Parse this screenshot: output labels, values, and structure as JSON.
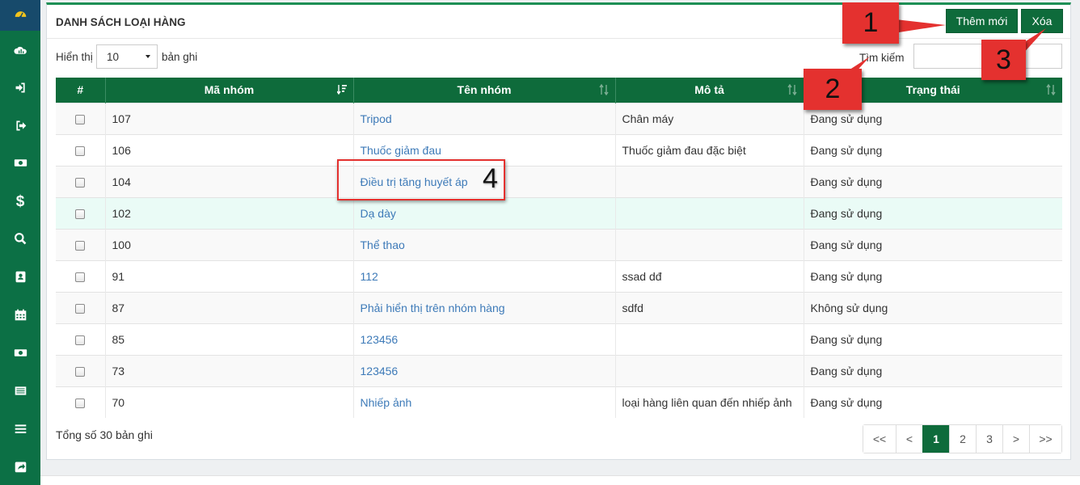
{
  "sidebar": {
    "items": [
      {
        "icon": "dashboard-icon"
      },
      {
        "icon": "cloud-chart-icon"
      },
      {
        "icon": "sign-in-icon"
      },
      {
        "icon": "sign-out-icon"
      },
      {
        "icon": "money-icon"
      },
      {
        "icon": "dollar-icon"
      },
      {
        "icon": "search-icon"
      },
      {
        "icon": "contact-book-icon"
      },
      {
        "icon": "calendar-icon"
      },
      {
        "icon": "money-icon"
      },
      {
        "icon": "list-icon"
      },
      {
        "icon": "bars-icon"
      },
      {
        "icon": "share-icon"
      }
    ]
  },
  "panel": {
    "title": "DANH SÁCH LOẠI HÀNG",
    "add_button": "Thêm mới",
    "delete_button": "Xóa"
  },
  "controls": {
    "show_label": "Hiển thị",
    "page_size": "10",
    "records_label": "bản ghi",
    "search_label": "Tìm kiếm",
    "search_value": ""
  },
  "table": {
    "columns": [
      "#",
      "Mã nhóm",
      "Tên nhóm",
      "Mô tả",
      "Trạng thái"
    ],
    "rows": [
      {
        "code": "107",
        "name": "Tripod",
        "description": "Chân máy",
        "status": "Đang sử dụng"
      },
      {
        "code": "106",
        "name": "Thuốc giảm đau",
        "description": "Thuốc giảm đau đặc biệt",
        "status": "Đang sử dụng"
      },
      {
        "code": "104",
        "name": "Điều trị tăng huyết áp",
        "description": "",
        "status": "Đang sử dụng"
      },
      {
        "code": "102",
        "name": "Dạ dày",
        "description": "",
        "status": "Đang sử dụng"
      },
      {
        "code": "100",
        "name": "Thể thao",
        "description": "",
        "status": "Đang sử dụng"
      },
      {
        "code": "91",
        "name": "112",
        "description": "ssad dđ",
        "status": "Đang sử dụng"
      },
      {
        "code": "87",
        "name": "Phải hiển thị trên nhóm hàng",
        "description": "sdfd",
        "status": "Không sử dụng"
      },
      {
        "code": "85",
        "name": "123456",
        "description": "",
        "status": "Đang sử dụng"
      },
      {
        "code": "73",
        "name": "123456",
        "description": "",
        "status": "Đang sử dụng"
      },
      {
        "code": "70",
        "name": "Nhiếp ảnh",
        "description": "loại hàng liên quan đến nhiếp ảnh",
        "status": "Đang sử dụng"
      }
    ]
  },
  "footer": {
    "total_label": "Tổng số 30 bản ghi"
  },
  "pagination": {
    "first": "<<",
    "prev": "<",
    "pages": [
      "1",
      "2",
      "3"
    ],
    "current": "1",
    "next": ">",
    "last": ">>"
  },
  "annotations": {
    "callout_1": "1",
    "callout_2": "2",
    "callout_3": "3",
    "callout_4": "4"
  },
  "colors": {
    "sidebar": "#0c7045",
    "header": "#0e6b3b",
    "link": "#3d7ab8",
    "callout": "#e4312f",
    "row_hover": "#eafbf6"
  }
}
